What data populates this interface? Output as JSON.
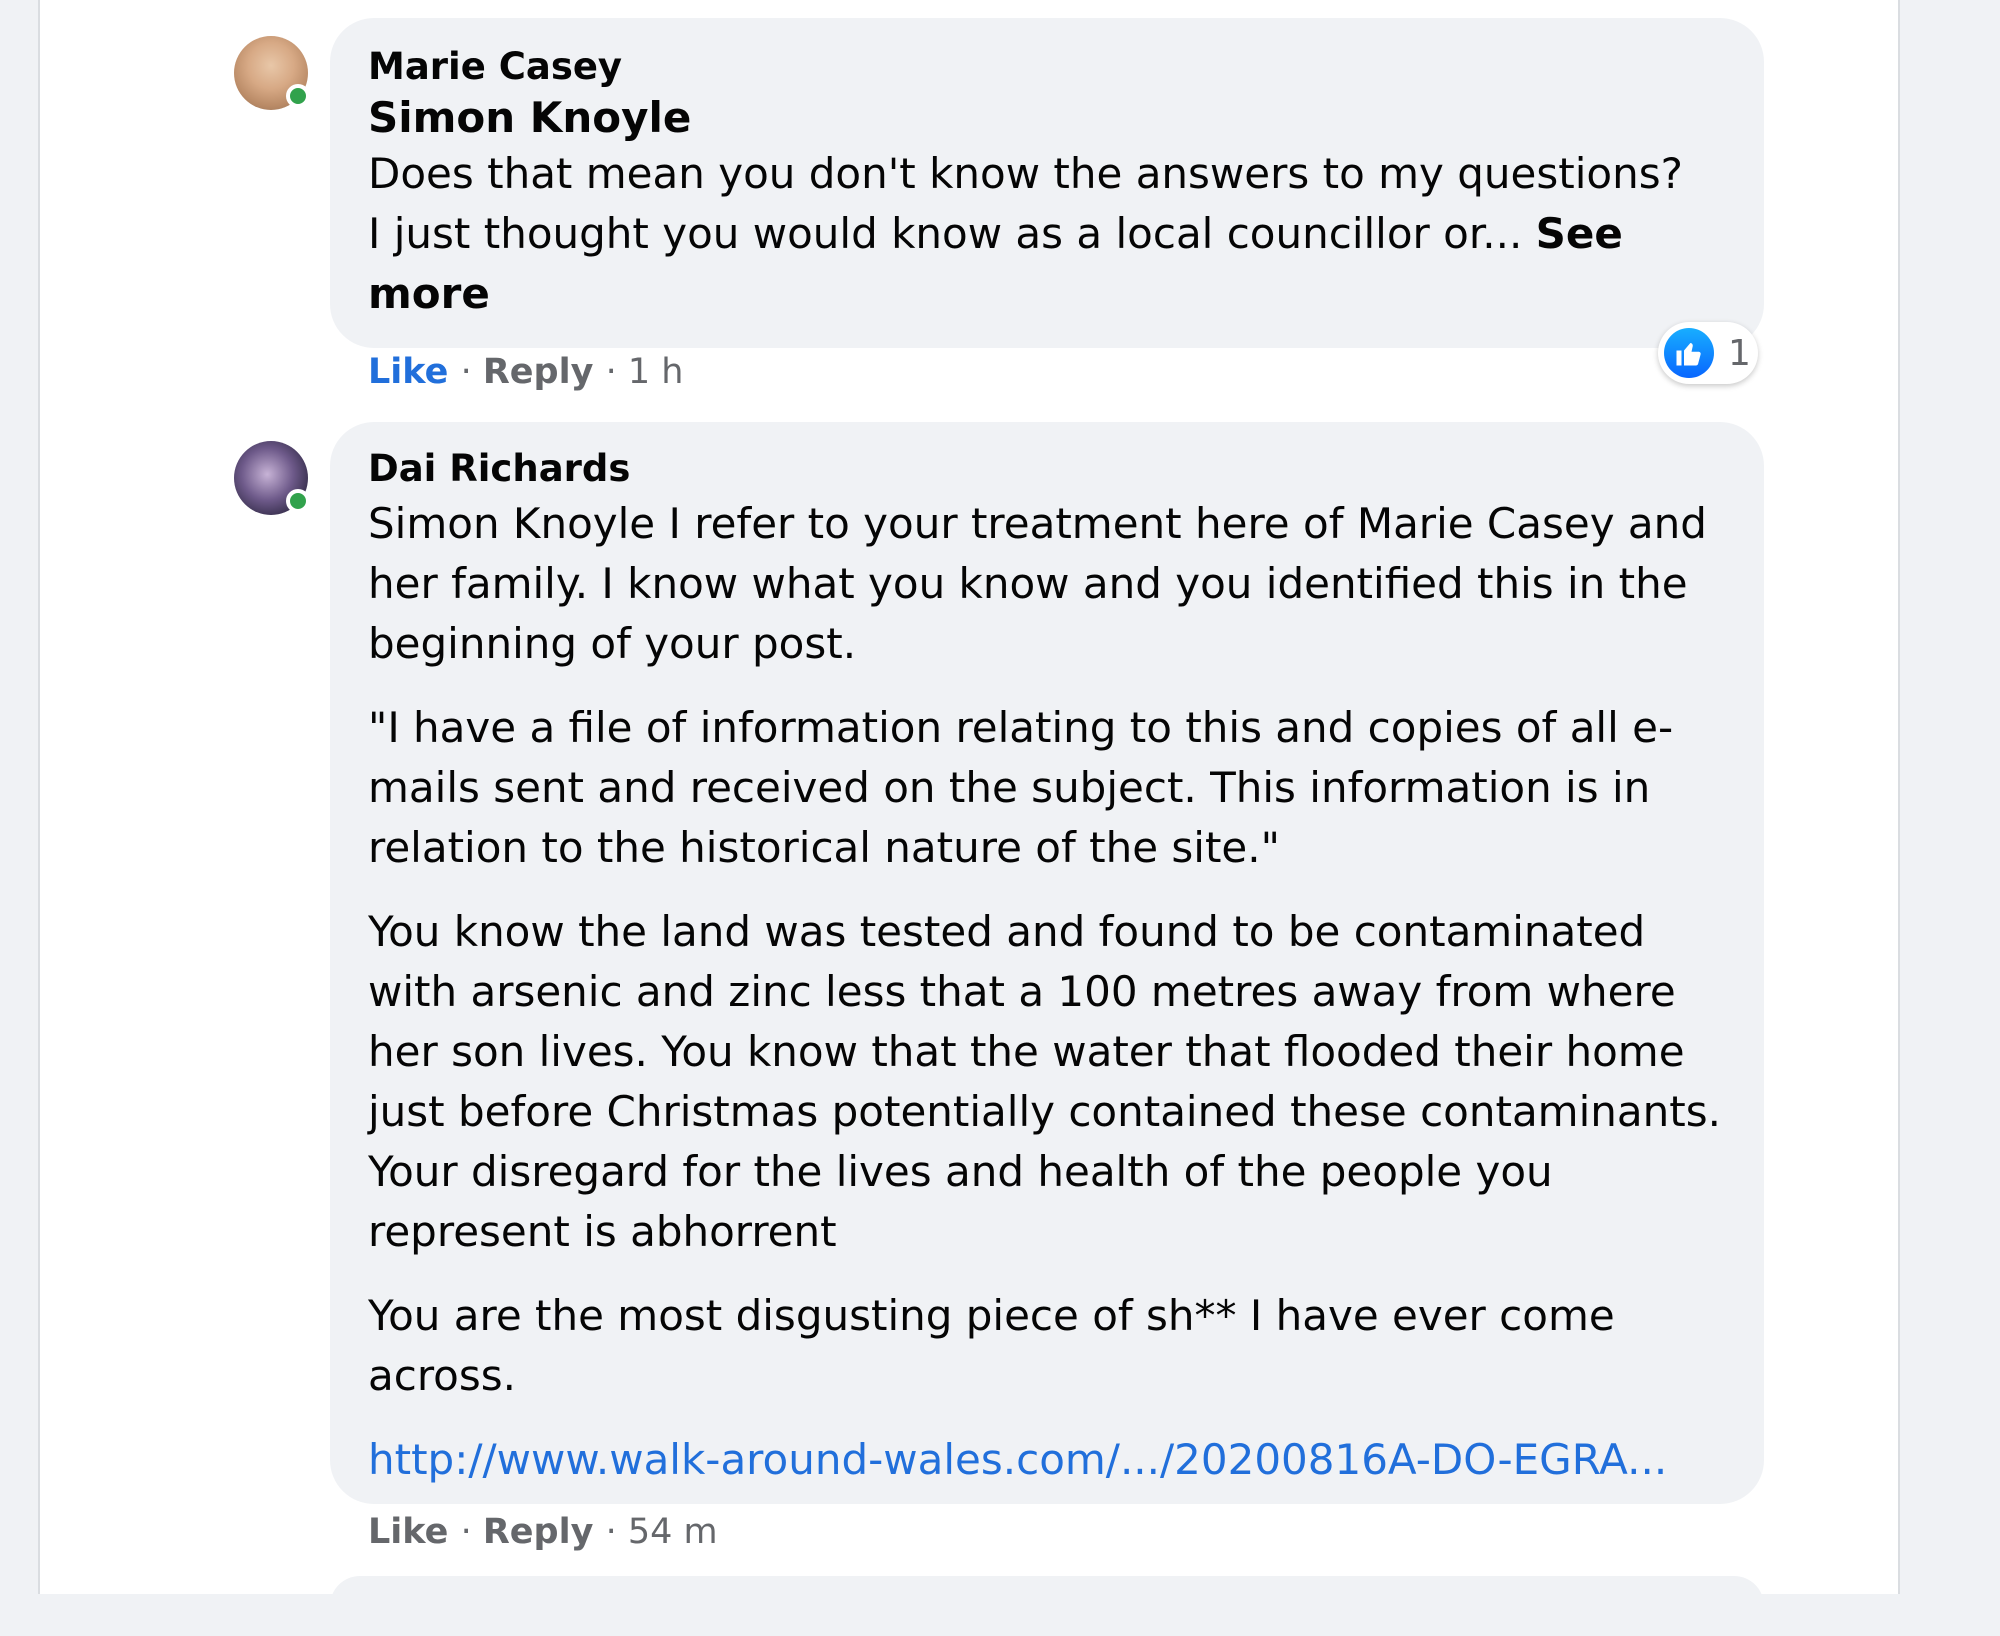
{
  "comment1": {
    "author": "Marie Casey",
    "mention": "Simon Knoyle",
    "text_line1": "Does that mean you don't know the answers to my questions?",
    "text_line2": "I just thought you would know as a local councillor or... ",
    "see_more": "See more",
    "actions": {
      "like": "Like",
      "reply": "Reply",
      "time": "1 h"
    },
    "reaction": {
      "icon": "thumbs-up-icon",
      "count": "1"
    }
  },
  "comment2": {
    "author": "Dai Richards",
    "paragraphs": [
      "Simon Knoyle I refer to your treatment here of Marie Casey and her family. I know what you know and you identified this in the beginning of your post.",
      "\"I have a file of information relating to this and copies of all e-mails sent and received on the subject. This information is in relation to the historical nature of the site.\"",
      "You know the land was tested and found to be contaminated with arsenic and zinc less that a 100 metres away from where her son lives. You know that the water that flooded their home just before Christmas potentially contained these contaminants. Your disregard for the lives and health of the people you represent is abhorrent",
      "You are the most disgusting piece of sh** I have ever come across."
    ],
    "link": "http://www.walk-around-wales.com/.../20200816A-DO-EGRA...",
    "actions": {
      "like": "Like",
      "reply": "Reply",
      "time": "54 m"
    }
  },
  "separator": "·",
  "colors": {
    "link": "#216fdb",
    "bubble": "#f0f2f5",
    "online": "#31a24c",
    "muted": "#65676b"
  }
}
